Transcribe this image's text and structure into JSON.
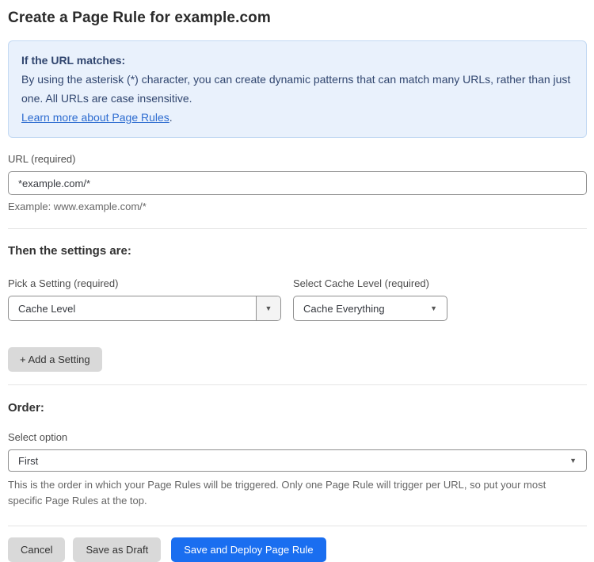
{
  "page": {
    "title": "Create a Page Rule for example.com"
  },
  "info_box": {
    "heading": "If the URL matches:",
    "body": "By using the asterisk (*) character, you can create dynamic patterns that can match many URLs, rather than just one. All URLs are case insensitive.",
    "link_label": "Learn more about Page Rules",
    "link_suffix": "."
  },
  "url_field": {
    "label": "URL (required)",
    "value": "*example.com/*",
    "helper": "Example: www.example.com/*"
  },
  "settings_section": {
    "heading": "Then the settings are:",
    "setting_select": {
      "label": "Pick a Setting (required)",
      "value": "Cache Level"
    },
    "cache_level_select": {
      "label": "Select Cache Level (required)",
      "value": "Cache Everything"
    },
    "add_setting_label": "+ Add a Setting"
  },
  "order_section": {
    "heading": "Order:",
    "select_label": "Select option",
    "value": "First",
    "helper": "This is the order in which your Page Rules will be triggered. Only one Page Rule will trigger per URL, so put your most specific Page Rules at the top."
  },
  "footer": {
    "cancel_label": "Cancel",
    "save_draft_label": "Save as Draft",
    "save_deploy_label": "Save and Deploy Page Rule"
  },
  "icons": {
    "dropdown_arrow": "▼"
  },
  "colors": {
    "info_box_bg": "#e9f1fc",
    "info_box_border": "#c3d9f3",
    "info_text": "#31466f",
    "link_blue": "#2d6cd0",
    "primary_button_blue": "#1a6ef0",
    "secondary_button_gray": "#d9d9d9",
    "divider_gray": "#e4e4e4"
  }
}
